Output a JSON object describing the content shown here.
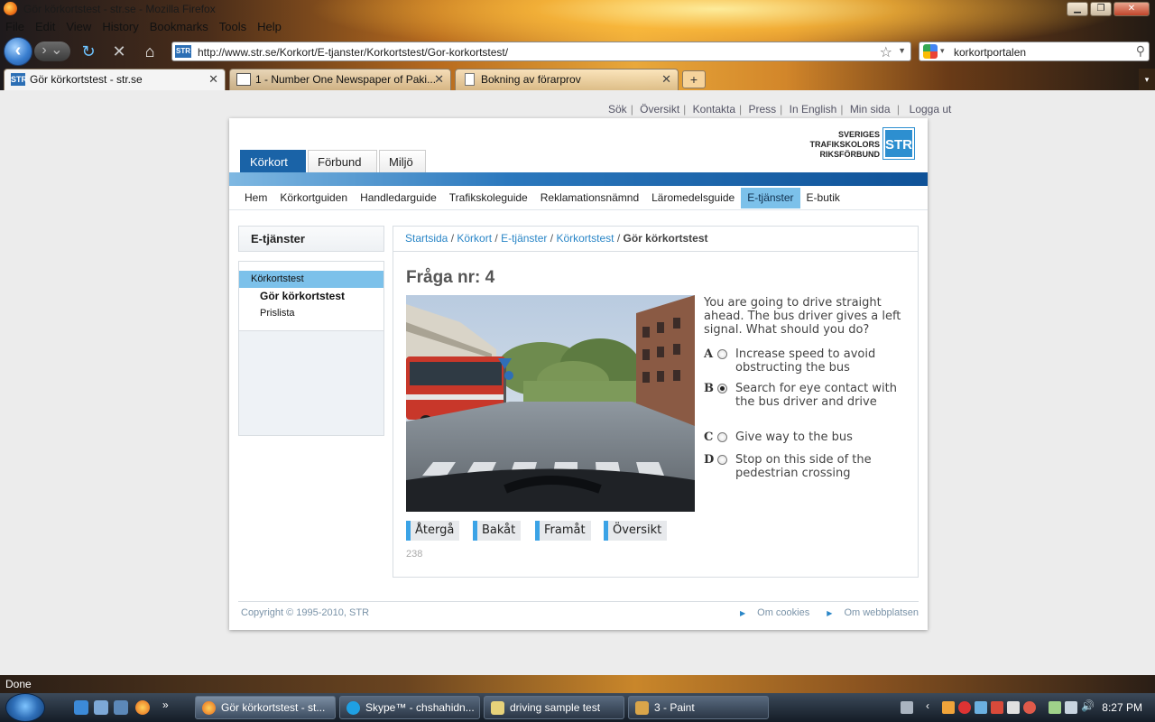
{
  "window": {
    "title": "Gör körkortstest - str.se - Mozilla Firefox"
  },
  "menubar": [
    "File",
    "Edit",
    "View",
    "History",
    "Bookmarks",
    "Tools",
    "Help"
  ],
  "navbar": {
    "url": "http://www.str.se/Korkort/E-tjanster/Korkortstest/Gor-korkortstest/",
    "site_icon_label": "STR",
    "search_value": "korkortportalen"
  },
  "tabs": [
    {
      "label": "Gör körkortstest - str.se",
      "icon": "STR",
      "active": true
    },
    {
      "label": "1 - Number One Newspaper of Paki...",
      "icon": "paper",
      "active": false
    },
    {
      "label": "Bokning av förarprov",
      "icon": "page",
      "active": false
    }
  ],
  "page": {
    "top_links": [
      "Sök",
      "Översikt",
      "Kontakta",
      "Press",
      "In English",
      "Min sida",
      "Logga ut"
    ],
    "logo": {
      "line1": "SVERIGES",
      "line2": "TRAFIKSKOLORS",
      "line3": "RIKSFÖRBUND",
      "box": "STR"
    },
    "main_tabs": [
      "Körkort",
      "Förbund",
      "Miljö"
    ],
    "sub_nav": [
      "Hem",
      "Körkortguiden",
      "Handledarguide",
      "Trafikskoleguide",
      "Reklamationsnämnd",
      "Läromedelsguide",
      "E-tjänster",
      "E-butik"
    ],
    "sub_nav_active": "E-tjänster",
    "sidebar": {
      "heading": "E-tjänster",
      "items": [
        "Körkortstest",
        "Gör körkortstest",
        "Prislista"
      ]
    },
    "breadcrumb": {
      "links": [
        "Startsida",
        "Körkort",
        "E-tjänster",
        "Körkortstest"
      ],
      "current": "Gör körkortstest"
    },
    "question": {
      "title": "Fråga nr: 4",
      "text": "You are going to drive straight ahead. The bus driver gives a left signal. What should you do?",
      "answers": [
        {
          "letter": "A",
          "text": "Increase speed to avoid obstructing the bus",
          "checked": false
        },
        {
          "letter": "B",
          "text": "Search for eye contact with the bus driver and drive",
          "checked": true
        },
        {
          "letter": "C",
          "text": "Give way to the bus",
          "checked": false
        },
        {
          "letter": "D",
          "text": "Stop on this side of the pedestrian crossing",
          "checked": false
        }
      ],
      "buttons": [
        "Återgå",
        "Bakåt",
        "Framåt",
        "Översikt"
      ],
      "id_number": "238"
    },
    "footer": {
      "copyright": "Copyright © 1995-2010, STR",
      "links": [
        "Om cookies",
        "Om webbplatsen"
      ]
    }
  },
  "statusbar": {
    "text": "Done"
  },
  "taskbar": {
    "items": [
      {
        "label": "Gör körkortstest - st...",
        "icon": "firefox",
        "active": true
      },
      {
        "label": "Skype™ - chshahidn...",
        "icon": "skype",
        "active": false
      },
      {
        "label": "driving sample test",
        "icon": "notepad",
        "active": false
      },
      {
        "label": "3 - Paint",
        "icon": "paint",
        "active": false
      }
    ],
    "clock": "8:27 PM"
  },
  "colors": {
    "str_blue": "#1a63a7",
    "link_blue": "#2a86c7",
    "active_highlight": "#7cc1ea"
  }
}
